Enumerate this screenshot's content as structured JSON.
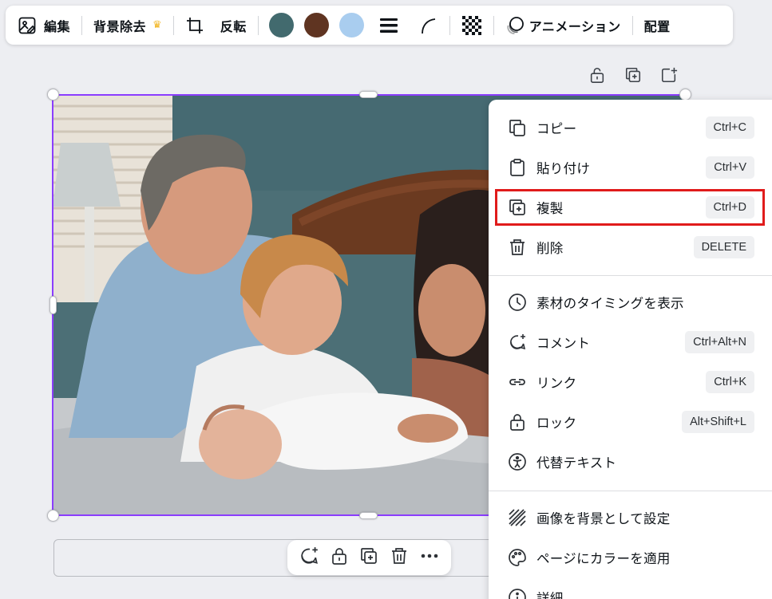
{
  "toolbar": {
    "edit_label": "編集",
    "remove_bg_label": "背景除去",
    "flip_label": "反転",
    "animate_label": "アニメーション",
    "position_label": "配置",
    "colors": [
      "#426a6e",
      "#5f3421",
      "#a9cdef"
    ],
    "icons": [
      "image-edit-icon",
      "crown-icon",
      "crop-icon",
      "line-weight-icon",
      "corner-rounding-icon",
      "transparency-icon",
      "animation-icon"
    ]
  },
  "context_menu": {
    "groups": [
      [
        {
          "label": "コピー",
          "shortcut": "Ctrl+C",
          "icon": "copy-icon"
        },
        {
          "label": "貼り付け",
          "shortcut": "Ctrl+V",
          "icon": "paste-icon"
        },
        {
          "label": "複製",
          "shortcut": "Ctrl+D",
          "icon": "duplicate-icon",
          "highlighted": true
        },
        {
          "label": "削除",
          "shortcut": "DELETE",
          "icon": "trash-icon"
        }
      ],
      [
        {
          "label": "素材のタイミングを表示",
          "icon": "clock-icon"
        },
        {
          "label": "コメント",
          "shortcut": "Ctrl+Alt+N",
          "icon": "comment-icon"
        },
        {
          "label": "リンク",
          "shortcut": "Ctrl+K",
          "icon": "link-icon"
        },
        {
          "label": "ロック",
          "shortcut": "Alt+Shift+L",
          "icon": "lock-icon"
        },
        {
          "label": "代替テキスト",
          "icon": "accessibility-icon"
        }
      ],
      [
        {
          "label": "画像を背景として設定",
          "icon": "background-pattern-icon"
        },
        {
          "label": "ページにカラーを適用",
          "icon": "palette-icon"
        },
        {
          "label": "詳細",
          "icon": "info-icon"
        }
      ]
    ]
  },
  "highlight_color": "#e01b1b",
  "selection_color": "#8b3dff",
  "page_actions": [
    "lock-page-icon",
    "duplicate-page-icon",
    "add-page-icon"
  ],
  "floating_toolbar": [
    "add-comment-icon",
    "lock-icon",
    "duplicate-icon",
    "trash-icon",
    "more-icon"
  ]
}
